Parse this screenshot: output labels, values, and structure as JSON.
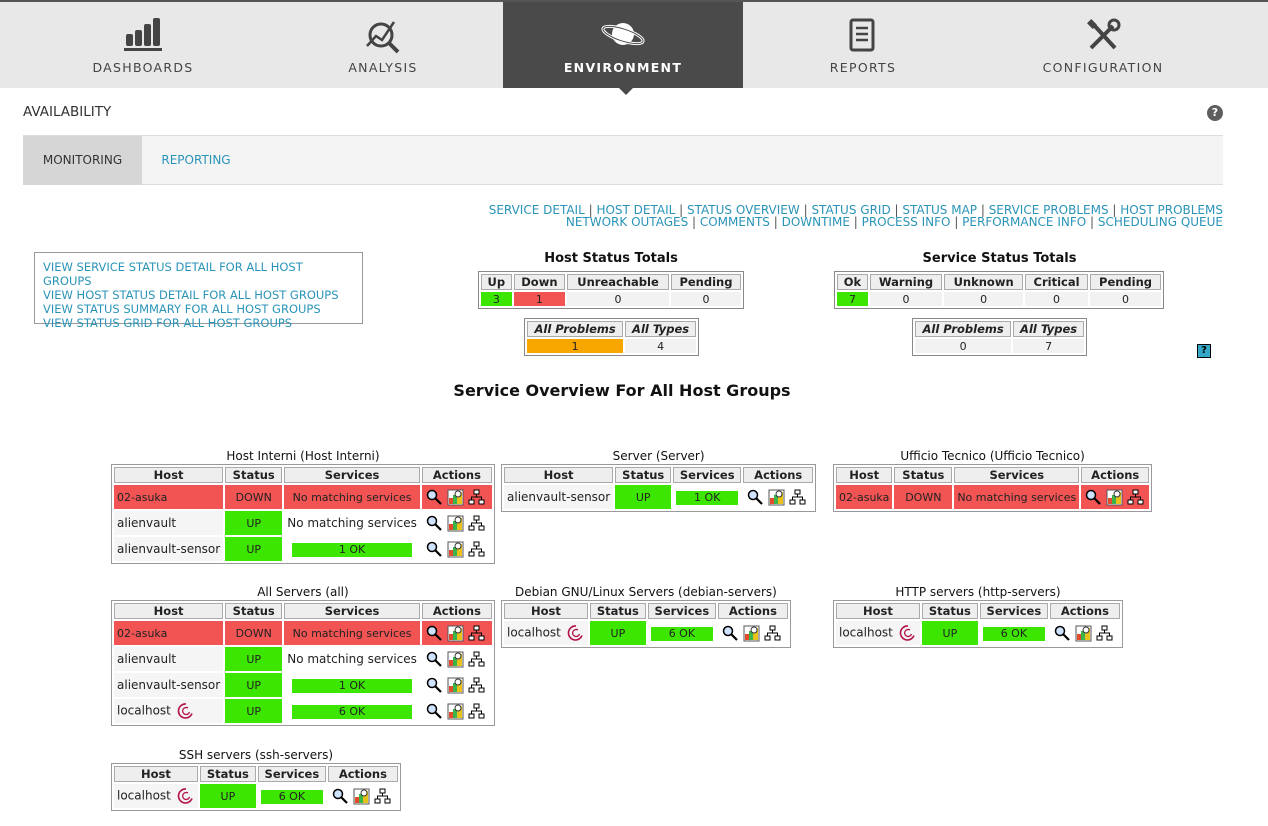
{
  "nav": {
    "tabs": [
      {
        "label": "DASHBOARDS",
        "icon": "bar-chart-icon"
      },
      {
        "label": "ANALYSIS",
        "icon": "magnifier-analysis-icon"
      },
      {
        "label": "ENVIRONMENT",
        "icon": "planet-icon",
        "active": true
      },
      {
        "label": "REPORTS",
        "icon": "report-document-icon"
      },
      {
        "label": "CONFIGURATION",
        "icon": "tools-icon"
      }
    ]
  },
  "page": {
    "title": "AVAILABILITY",
    "help": "?"
  },
  "subtabs": {
    "monitoring": "MONITORING",
    "reporting": "REPORTING"
  },
  "links_row1": [
    "SERVICE DETAIL",
    "HOST DETAIL",
    "STATUS OVERVIEW",
    "STATUS GRID",
    "STATUS MAP",
    "SERVICE PROBLEMS",
    "HOST PROBLEMS"
  ],
  "links_row2": [
    "NETWORK OUTAGES",
    "COMMENTS",
    "DOWNTIME",
    "PROCESS INFO",
    "PERFORMANCE INFO",
    "SCHEDULING QUEUE"
  ],
  "view_links": [
    "VIEW SERVICE STATUS DETAIL FOR ALL HOST GROUPS",
    "VIEW HOST STATUS DETAIL FOR ALL HOST GROUPS",
    "VIEW STATUS SUMMARY FOR ALL HOST GROUPS",
    "VIEW STATUS GRID FOR ALL HOST GROUPS"
  ],
  "host_totals": {
    "title": "Host Status Totals",
    "headers": [
      "Up",
      "Down",
      "Unreachable",
      "Pending"
    ],
    "values": [
      "3",
      "1",
      "0",
      "0"
    ],
    "problems_headers": [
      "All Problems",
      "All Types"
    ],
    "problems_values": [
      "1",
      "4"
    ]
  },
  "service_totals": {
    "title": "Service Status Totals",
    "headers": [
      "Ok",
      "Warning",
      "Unknown",
      "Critical",
      "Pending"
    ],
    "values": [
      "7",
      "0",
      "0",
      "0",
      "0"
    ],
    "problems_headers": [
      "All Problems",
      "All Types"
    ],
    "problems_values": [
      "0",
      "7"
    ]
  },
  "help_icon_label": "?",
  "overview_title": "Service Overview For All Host Groups",
  "group_headers": [
    "Host",
    "Status",
    "Services",
    "Actions"
  ],
  "groups": [
    {
      "title": "Host Interni (Host Interni)",
      "rows": [
        {
          "host": "02-asuka",
          "status": "DOWN",
          "services": "No matching services"
        },
        {
          "host": "alienvault",
          "status": "UP",
          "services": "No matching services"
        },
        {
          "host": "alienvault-sensor",
          "status": "UP",
          "services": "1 OK"
        }
      ]
    },
    {
      "title": "Server (Server)",
      "rows": [
        {
          "host": "alienvault-sensor",
          "status": "UP",
          "services": "1 OK"
        }
      ]
    },
    {
      "title": "Ufficio Tecnico (Ufficio Tecnico)",
      "rows": [
        {
          "host": "02-asuka",
          "status": "DOWN",
          "services": "No matching services"
        }
      ]
    },
    {
      "title": "All Servers (all)",
      "rows": [
        {
          "host": "02-asuka",
          "status": "DOWN",
          "services": "No matching services"
        },
        {
          "host": "alienvault",
          "status": "UP",
          "services": "No matching services"
        },
        {
          "host": "alienvault-sensor",
          "status": "UP",
          "services": "1 OK"
        },
        {
          "host": "localhost",
          "status": "UP",
          "services": "6 OK"
        }
      ]
    },
    {
      "title": "Debian GNU/Linux Servers (debian-servers)",
      "rows": [
        {
          "host": "localhost",
          "status": "UP",
          "services": "6 OK"
        }
      ]
    },
    {
      "title": "HTTP servers (http-servers)",
      "rows": [
        {
          "host": "localhost",
          "status": "UP",
          "services": "6 OK"
        }
      ]
    },
    {
      "title": "SSH servers (ssh-servers)",
      "rows": [
        {
          "host": "localhost",
          "status": "UP",
          "services": "6 OK"
        }
      ]
    }
  ],
  "colors": {
    "ok": "#3de600",
    "down": "#f25454",
    "problem": "#f7a700",
    "link": "#2a94b8",
    "nav_active": "#4a4a4a"
  }
}
